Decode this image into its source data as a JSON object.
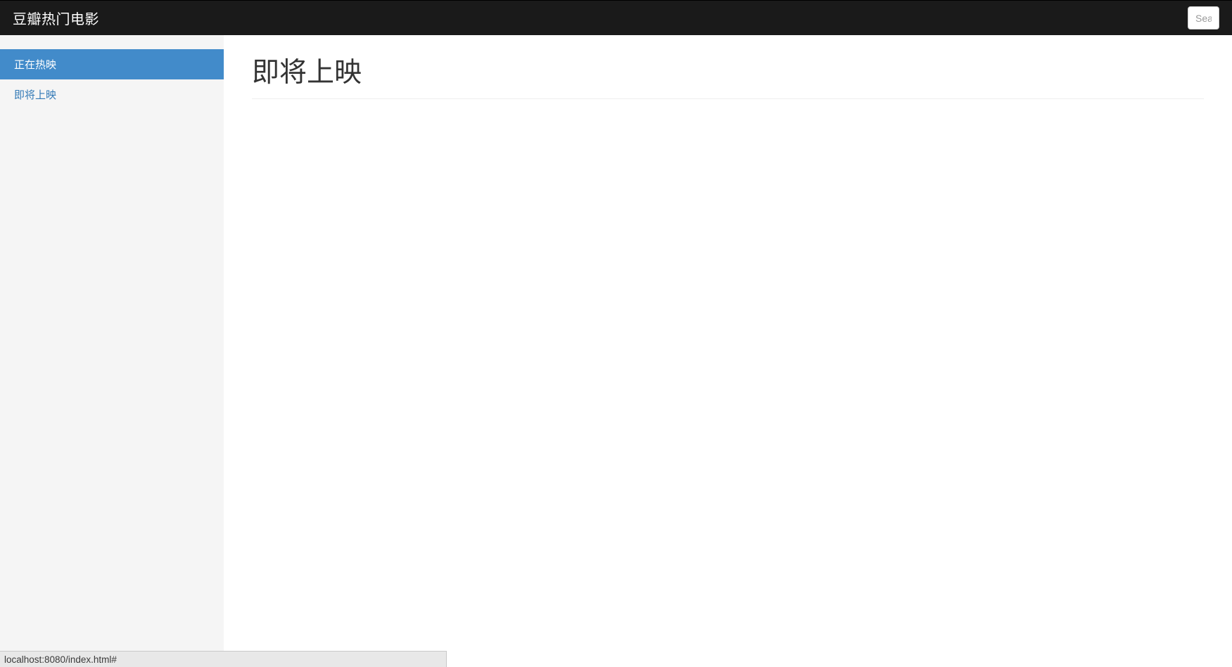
{
  "navbar": {
    "brand": "豆瓣热门电影",
    "search_placeholder": "Sear"
  },
  "sidebar": {
    "items": [
      {
        "label": "正在热映",
        "active": true
      },
      {
        "label": "即将上映",
        "active": false
      }
    ]
  },
  "main": {
    "title": "即将上映"
  },
  "status": {
    "text": "localhost:8080/index.html#"
  }
}
